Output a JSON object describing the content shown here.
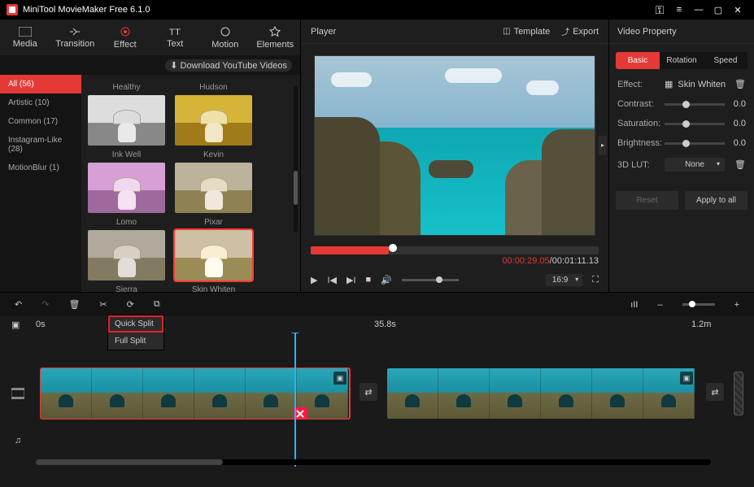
{
  "app": {
    "title": "MiniTool MovieMaker Free 6.1.0"
  },
  "tabs": [
    "Media",
    "Transition",
    "Effect",
    "Text",
    "Motion",
    "Elements"
  ],
  "dl": "Download YouTube Videos",
  "cats": [
    {
      "label": "All (56)",
      "active": true
    },
    {
      "label": "Artistic (10)"
    },
    {
      "label": "Common (17)"
    },
    {
      "label": "Instagram-Like (28)"
    },
    {
      "label": "MotionBlur (1)"
    }
  ],
  "effects_row0": [
    "Healthy",
    "Hudson"
  ],
  "effects": [
    "Ink Well",
    "Kevin",
    "Lomo",
    "Pixar",
    "Sierra",
    "Skin Whiten"
  ],
  "player": {
    "title": "Player",
    "template": "Template",
    "export": "Export",
    "cur": "00:00:29.05",
    "total": "00:01:11.13",
    "sep": " / ",
    "aspect": "16:9"
  },
  "props": {
    "title": "Video Property",
    "tabs": [
      "Basic",
      "Rotation",
      "Speed"
    ],
    "effect_label": "Effect:",
    "effect_name": "Skin Whiten",
    "rows": [
      {
        "label": "Contrast:",
        "val": "0.0"
      },
      {
        "label": "Saturation:",
        "val": "0.0"
      },
      {
        "label": "Brightness:",
        "val": "0.0"
      }
    ],
    "lut": "3D LUT:",
    "lut_val": "None",
    "reset": "Reset",
    "apply": "Apply to all"
  },
  "split": {
    "quick": "Quick Split",
    "full": "Full Split"
  },
  "ruler": {
    "t0": "0s",
    "t1": "35.8s",
    "t2": "1.2m"
  }
}
